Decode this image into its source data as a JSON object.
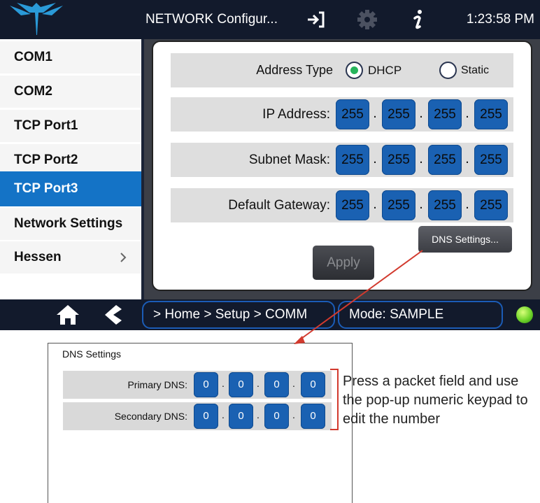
{
  "header": {
    "title": "NETWORK Configur...",
    "time": "1:23:58 PM",
    "icons": [
      "teledyne-logo",
      "sign-in-icon",
      "gear-icon",
      "info-icon"
    ]
  },
  "sidebar": {
    "items": [
      {
        "label": "COM1",
        "active": false
      },
      {
        "label": "COM2",
        "active": false
      },
      {
        "label": "TCP Port1",
        "active": false
      },
      {
        "label": "TCP Port2",
        "active": false
      },
      {
        "label": "TCP Port3",
        "active": true
      },
      {
        "label": "Network Settings",
        "active": false
      },
      {
        "label": "Hessen",
        "active": false,
        "has_submenu": true
      }
    ]
  },
  "network": {
    "address_type": {
      "label": "Address Type",
      "options": [
        "DHCP",
        "Static"
      ],
      "selected": "DHCP"
    },
    "ip_address": {
      "label": "IP Address:",
      "octets": [
        "255",
        "255",
        "255",
        "255"
      ]
    },
    "subnet_mask": {
      "label": "Subnet Mask:",
      "octets": [
        "255",
        "255",
        "255",
        "255"
      ]
    },
    "default_gateway": {
      "label": "Default Gateway:",
      "octets": [
        "255",
        "255",
        "255",
        "255"
      ]
    },
    "separator": ".",
    "dns_button": "DNS Settings...",
    "apply_button": "Apply"
  },
  "footer": {
    "breadcrumb": "> Home > Setup > COMM",
    "mode": "Mode: SAMPLE",
    "icons": [
      "home-icon",
      "back-icon",
      "status-led"
    ]
  },
  "dns_popup": {
    "title": "DNS Settings",
    "primary": {
      "label": "Primary DNS:",
      "octets": [
        "0",
        "0",
        "0",
        "0"
      ]
    },
    "secondary": {
      "label": "Secondary DNS:",
      "octets": [
        "0",
        "0",
        "0",
        "0"
      ]
    }
  },
  "annotation": {
    "text": "Press a packet field and use the pop-up numeric keypad to edit the number"
  },
  "colors": {
    "topbar": "#121a2c",
    "accent_blue": "#1473c6",
    "octet_blue": "#1a61b2",
    "annotation_red": "#d23a2e",
    "radio_selected": "#26b45b",
    "status_led": "#6fd42a"
  }
}
